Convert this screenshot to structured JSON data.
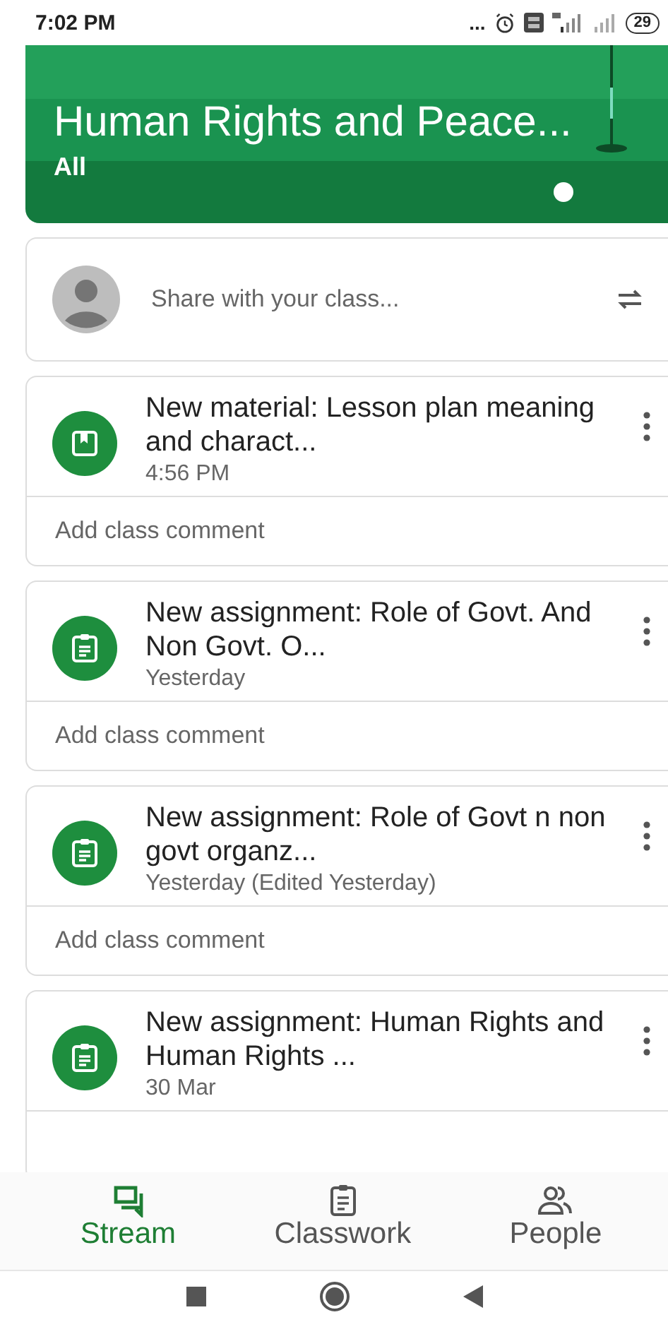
{
  "status_bar": {
    "time": "7:02 PM",
    "more": "...",
    "battery": "29"
  },
  "banner": {
    "title": "Human Rights and Peace...",
    "subtitle": "All"
  },
  "share": {
    "placeholder": "Share with your class..."
  },
  "posts": [
    {
      "kind": "material",
      "title": "New material: Lesson plan meaning and charact...",
      "time": "4:56 PM",
      "comment_placeholder": "Add class comment"
    },
    {
      "kind": "assignment",
      "title": "New assignment: Role of Govt. And Non Govt. O...",
      "time": "Yesterday",
      "comment_placeholder": "Add class comment"
    },
    {
      "kind": "assignment",
      "title": "New assignment: Role of Govt n non govt organz...",
      "time": "Yesterday (Edited Yesterday)",
      "comment_placeholder": "Add class comment"
    },
    {
      "kind": "assignment",
      "title": "New assignment: Human Rights and Human Rights ...",
      "time": "30 Mar"
    }
  ],
  "tabs": [
    {
      "kind": "stream",
      "label": "Stream",
      "selected": true
    },
    {
      "kind": "classwork",
      "label": "Classwork",
      "selected": false
    },
    {
      "kind": "people",
      "label": "People",
      "selected": false
    }
  ]
}
